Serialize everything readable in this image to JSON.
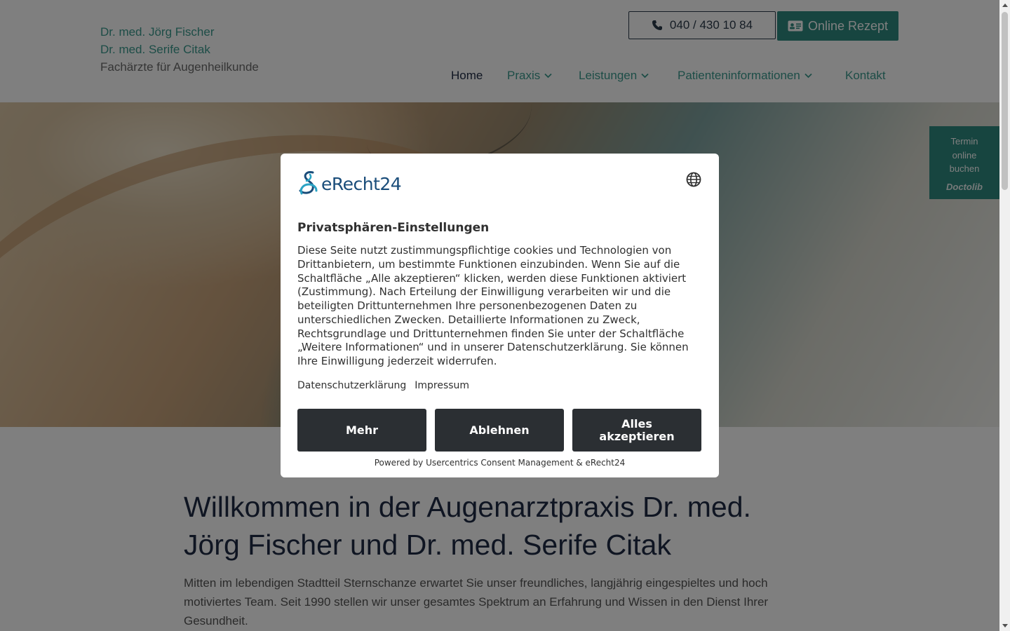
{
  "header": {
    "logo_line1": "Dr. med. Jörg Fischer",
    "logo_line2": "Dr. med. Serife Citak",
    "logo_line3": "Fachärzte für Augenheilkunde",
    "phone_label": "040 / 430 10 84",
    "rezept_label": "Online Rezept",
    "nav": [
      {
        "label": "Home",
        "has_dropdown": false,
        "active": true
      },
      {
        "label": "Praxis",
        "has_dropdown": true
      },
      {
        "label": "Leistungen",
        "has_dropdown": true
      },
      {
        "label": "Patienteninformationen",
        "has_dropdown": true
      },
      {
        "label": "Kontakt",
        "has_dropdown": false
      }
    ]
  },
  "doctolib_widget": {
    "line1": "Termin",
    "line2": "online",
    "line3": "buchen",
    "brand": "Doctolib"
  },
  "main": {
    "title": "Willkommen in der Augenarztpraxis Dr. med. Jörg Fischer und Dr. med. Serife Citak",
    "text": "Mitten im lebendigen Stadtteil Sternschanze erwartet Sie unser freundliches, langjährig eingespieltes und hoch motiviertes Team. Seit 1990 stellen wir unser gesamtes Spektrum an Erfahrung und Wissen in den Dienst Ihrer Gesundheit."
  },
  "consent_modal": {
    "brand": "eRecht24",
    "title": "Privatsphären-Einstellungen",
    "description": "Diese Seite nutzt zustimmungspflichtige cookies und Technologien von Drittanbietern, um bestimmte Funktionen einzubinden. Wenn Sie auf die Schaltfläche „Alle akzeptieren“ klicken, werden diese Funktionen aktiviert (Zustimmung). Nach Erteilung der Einwilligung verarbeiten wir und die beteiligten Drittunternehmen Ihre personenbezogenen Daten zu unterschiedlichen Zwecken. Detaillierte Informationen zu Zweck, Rechtsgrundlage und Drittunternehmen finden Sie unter der Schaltfläche „Weitere Informationen“ und in unserer Datenschutzerklärung. Sie können Ihre Einwilligung jederzeit widerrufen.",
    "link_privacy": "Datenschutzerklärung",
    "link_imprint": "Impressum",
    "btn_more": "Mehr",
    "btn_decline": "Ablehnen",
    "btn_accept": "Alles akzeptieren",
    "powered_by": "Powered by Usercentrics Consent Management & eRecht24"
  },
  "colors": {
    "accent": "#2f8a80",
    "nav_text": "#3a9a8e",
    "heading": "#1e2a44",
    "modal_button": "#2b2f33"
  }
}
